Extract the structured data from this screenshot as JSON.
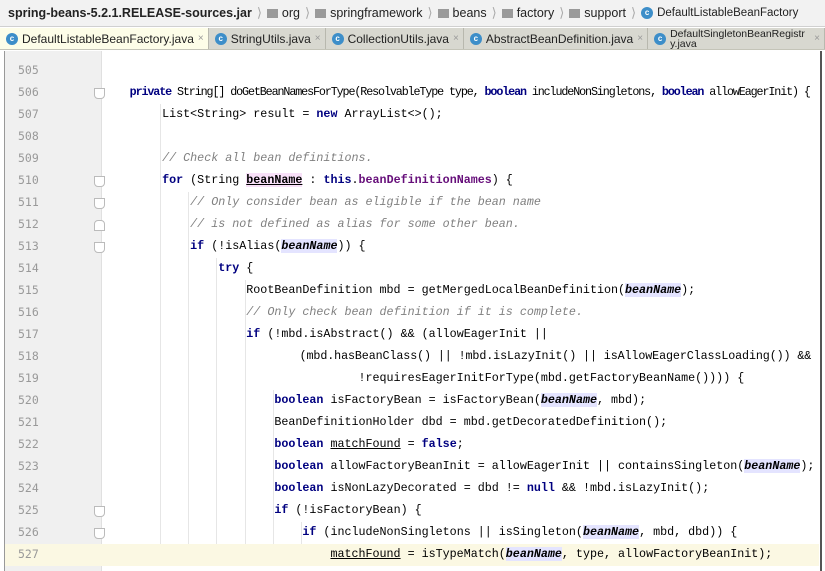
{
  "breadcrumb": [
    {
      "label": "spring-beans-5.2.1.RELEASE-sources.jar",
      "icon": "none"
    },
    {
      "label": "org",
      "icon": "folder-icon"
    },
    {
      "label": "springframework",
      "icon": "folder-icon"
    },
    {
      "label": "beans",
      "icon": "folder-icon"
    },
    {
      "label": "factory",
      "icon": "folder-icon"
    },
    {
      "label": "support",
      "icon": "folder-icon"
    },
    {
      "label": "DefaultListableBeanFactory",
      "icon": "class-icon"
    }
  ],
  "tabs": [
    {
      "label": "DefaultListableBeanFactory.java",
      "active": true
    },
    {
      "label": "StringUtils.java",
      "active": false
    },
    {
      "label": "CollectionUtils.java",
      "active": false
    },
    {
      "label": "AbstractBeanDefinition.java",
      "active": false
    },
    {
      "label": "DefaultSingletonBeanRegistry.java",
      "active": false
    }
  ],
  "tab_close_glyph": "×",
  "class_icon_letter": "c",
  "current_line": 527,
  "colors": {
    "keyword": "#000080",
    "comment": "#808080",
    "field": "#660e7a",
    "current_line": "#fbf8e3"
  },
  "lines": [
    {
      "n": 505,
      "fold": "",
      "t": []
    },
    {
      "n": 506,
      "fold": "start",
      "t": [
        [
          "",
          "    "
        ],
        [
          "kw",
          "private"
        ],
        [
          "",
          " String[] doGetBeanNamesForType(ResolvableType type, "
        ],
        [
          "kw",
          "boolean"
        ],
        [
          "",
          " includeNonSingletons, "
        ],
        [
          "kw",
          "boolean"
        ],
        [
          "",
          " allowEagerInit) {"
        ]
      ]
    },
    {
      "n": 507,
      "fold": "",
      "t": [
        [
          "",
          "        List<String> result = "
        ],
        [
          "kw",
          "new"
        ],
        [
          "",
          " ArrayList<>();"
        ]
      ]
    },
    {
      "n": 508,
      "fold": "",
      "t": []
    },
    {
      "n": 509,
      "fold": "",
      "t": [
        [
          "",
          "        "
        ],
        [
          "cmt",
          "// Check all bean definitions."
        ]
      ]
    },
    {
      "n": 510,
      "fold": "start",
      "t": [
        [
          "",
          "        "
        ],
        [
          "kw",
          "for"
        ],
        [
          "",
          " (String "
        ],
        [
          "decl",
          "beanName"
        ],
        [
          "",
          " : "
        ],
        [
          "kw",
          "this"
        ],
        [
          "",
          "."
        ],
        [
          "fld",
          "beanDefinitionNames"
        ],
        [
          "",
          ") {"
        ]
      ]
    },
    {
      "n": 511,
      "fold": "start",
      "t": [
        [
          "",
          "            "
        ],
        [
          "cmt",
          "// Only consider bean as eligible if the bean name"
        ]
      ]
    },
    {
      "n": 512,
      "fold": "end",
      "t": [
        [
          "",
          "            "
        ],
        [
          "cmt",
          "// is not defined as alias for some other bean."
        ]
      ]
    },
    {
      "n": 513,
      "fold": "start",
      "t": [
        [
          "",
          "            "
        ],
        [
          "kw",
          "if"
        ],
        [
          "",
          " (!isAlias("
        ],
        [
          "use",
          "beanName"
        ],
        [
          "",
          ")) {"
        ]
      ]
    },
    {
      "n": 514,
      "fold": "",
      "t": [
        [
          "",
          "                "
        ],
        [
          "kw",
          "try"
        ],
        [
          "",
          " {"
        ]
      ]
    },
    {
      "n": 515,
      "fold": "",
      "t": [
        [
          "",
          "                    RootBeanDefinition mbd = getMergedLocalBeanDefinition("
        ],
        [
          "use",
          "beanName"
        ],
        [
          "",
          ");"
        ]
      ]
    },
    {
      "n": 516,
      "fold": "",
      "t": [
        [
          "",
          "                    "
        ],
        [
          "cmt",
          "// Only check bean definition if it is complete."
        ]
      ]
    },
    {
      "n": 517,
      "fold": "",
      "t": [
        [
          "",
          "                    "
        ],
        [
          "kw",
          "if"
        ],
        [
          "",
          " (!mbd.isAbstract() && (allowEagerInit ||"
        ]
      ]
    },
    {
      "n": 518,
      "fold": "",
      "t": [
        [
          "",
          "                            (mbd.hasBeanClass() || !mbd.isLazyInit() || isAllowEagerClassLoading()) &&"
        ]
      ]
    },
    {
      "n": 519,
      "fold": "",
      "t": [
        [
          "",
          "                                    !requiresEagerInitForType(mbd.getFactoryBeanName()))) {"
        ]
      ]
    },
    {
      "n": 520,
      "fold": "",
      "t": [
        [
          "",
          "                        "
        ],
        [
          "kw",
          "boolean"
        ],
        [
          "",
          " isFactoryBean = isFactoryBean("
        ],
        [
          "use",
          "beanName"
        ],
        [
          "",
          ", mbd);"
        ]
      ]
    },
    {
      "n": 521,
      "fold": "",
      "t": [
        [
          "",
          "                        BeanDefinitionHolder dbd = mbd.getDecoratedDefinition();"
        ]
      ]
    },
    {
      "n": 522,
      "fold": "",
      "t": [
        [
          "",
          "                        "
        ],
        [
          "kw",
          "boolean"
        ],
        [
          "",
          " "
        ],
        [
          "ul",
          "matchFound"
        ],
        [
          "",
          " = "
        ],
        [
          "kw",
          "false"
        ],
        [
          "",
          ";"
        ]
      ]
    },
    {
      "n": 523,
      "fold": "",
      "t": [
        [
          "",
          "                        "
        ],
        [
          "kw",
          "boolean"
        ],
        [
          "",
          " allowFactoryBeanInit = allowEagerInit || containsSingleton("
        ],
        [
          "use",
          "beanName"
        ],
        [
          "",
          ");"
        ]
      ]
    },
    {
      "n": 524,
      "fold": "",
      "t": [
        [
          "",
          "                        "
        ],
        [
          "kw",
          "boolean"
        ],
        [
          "",
          " isNonLazyDecorated = dbd != "
        ],
        [
          "kw",
          "null"
        ],
        [
          "",
          " && !mbd.isLazyInit();"
        ]
      ]
    },
    {
      "n": 525,
      "fold": "start",
      "t": [
        [
          "",
          "                        "
        ],
        [
          "kw",
          "if"
        ],
        [
          "",
          " (!isFactoryBean) {"
        ]
      ]
    },
    {
      "n": 526,
      "fold": "start",
      "t": [
        [
          "",
          "                            "
        ],
        [
          "kw",
          "if"
        ],
        [
          "",
          " (includeNonSingletons || isSingleton("
        ],
        [
          "use",
          "beanName"
        ],
        [
          "",
          ", mbd, dbd)) {"
        ]
      ]
    },
    {
      "n": 527,
      "fold": "",
      "t": [
        [
          "",
          "                                "
        ],
        [
          "ul",
          "matchFound"
        ],
        [
          "",
          " = isTypeMatch("
        ],
        [
          "use",
          "beanName"
        ],
        [
          "",
          ", type, allowFactoryBeanInit);"
        ]
      ]
    }
  ]
}
